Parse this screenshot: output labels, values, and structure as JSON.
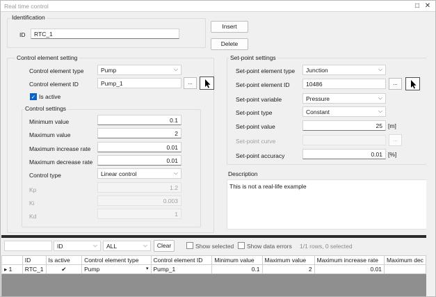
{
  "window": {
    "title": "Real time control"
  },
  "identification": {
    "group_label": "Identification",
    "id_label": "ID",
    "id_value": "RTC_1",
    "insert_label": "Insert",
    "delete_label": "Delete"
  },
  "control_element": {
    "group_label": "Control element setting",
    "type_label": "Control element type",
    "type_value": "Pump",
    "id_label": "Control element ID",
    "id_value": "Pump_1",
    "browse_label": "...",
    "is_active_label": "Is active",
    "is_active": true
  },
  "control_settings": {
    "group_label": "Control settings",
    "min_label": "Minimum value",
    "min_value": "0.1",
    "max_label": "Maximum value",
    "max_value": "2",
    "max_inc_label": "Maximum increase rate",
    "max_inc_value": "0.01",
    "max_dec_label": "Maximum decrease rate",
    "max_dec_value": "0.01",
    "control_type_label": "Control type",
    "control_type_value": "Linear control",
    "kp_label": "Kp",
    "kp_value": "1.2",
    "ki_label": "Ki",
    "ki_value": "0.003",
    "kd_label": "Kd",
    "kd_value": "1"
  },
  "setpoint": {
    "group_label": "Set-point settings",
    "elem_type_label": "Set-point element type",
    "elem_type_value": "Junction",
    "elem_id_label": "Set-point element ID",
    "elem_id_value": "10486",
    "browse_label": "...",
    "variable_label": "Set-point variable",
    "variable_value": "Pressure",
    "type_label": "Set-point type",
    "type_value": "Constant",
    "value_label": "Set-point value",
    "value_value": "25",
    "value_unit": "[m]",
    "curve_label": "Set-point curve",
    "curve_browse_label": "...",
    "accuracy_label": "Set-point accuracy",
    "accuracy_value": "0.01",
    "accuracy_unit": "[%]"
  },
  "description": {
    "label": "Description",
    "text": "This is not a real-life example"
  },
  "filter_bar": {
    "field_value": "ID",
    "scope_value": "ALL",
    "clear_label": "Clear",
    "show_selected_label": "Show selected",
    "show_errors_label": "Show data errors",
    "status": "1/1 rows, 0 selected"
  },
  "table": {
    "columns": [
      "",
      "ID",
      "Is active",
      "Control element type",
      "Control element ID",
      "Minimum value",
      "Maximum value",
      "Maximum increase rate",
      "Maximum dec"
    ],
    "rows": [
      {
        "row_num": "1",
        "id": "RTC_1",
        "is_active": "✔",
        "type": "Pump",
        "element_id": "Pump_1",
        "min": "0.1",
        "max": "2",
        "max_inc": "0.01"
      }
    ]
  },
  "icons": {
    "pick": "cursor-arrow-icon",
    "dropdown": "chevron-down-icon",
    "maximize": "maximize-icon",
    "close": "close-icon"
  },
  "colors": {
    "accent": "#0a64c8",
    "grid_bg": "#8f8f8f"
  }
}
